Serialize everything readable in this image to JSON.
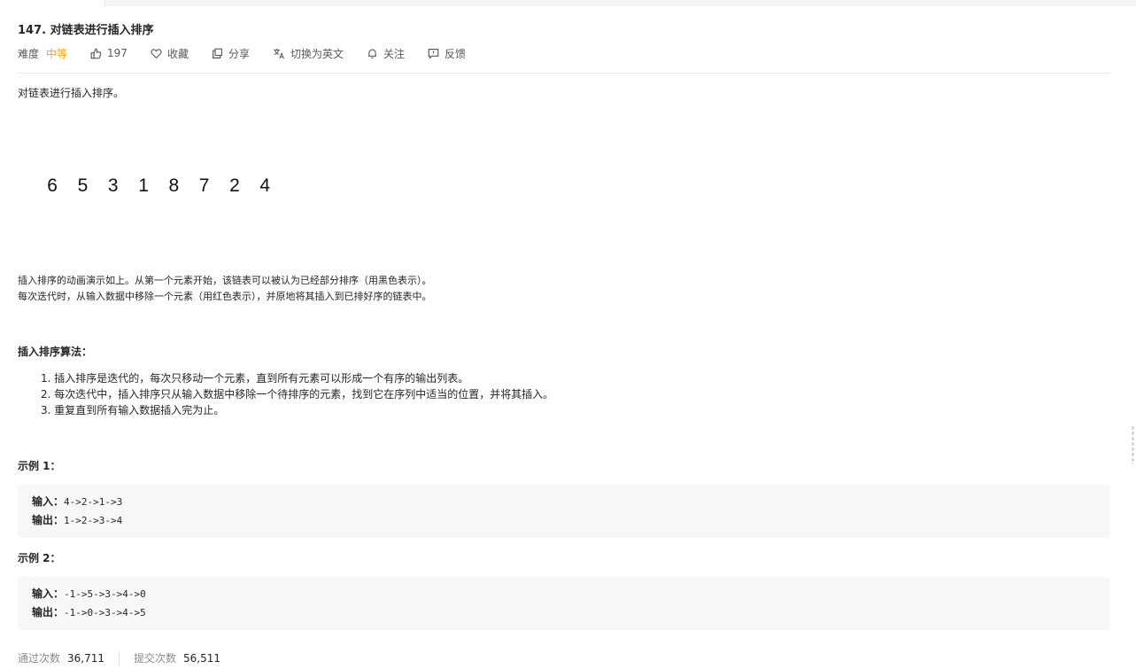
{
  "problem": {
    "title": "147. 对链表进行插入排序",
    "difficulty_label": "难度",
    "difficulty_value": "中等",
    "likes": "197",
    "actions": {
      "favorite": "收藏",
      "share": "分享",
      "translate": "切换为英文",
      "follow": "关注",
      "feedback": "反馈"
    },
    "intro": "对链表进行插入排序。",
    "animation_numbers": [
      "6",
      "5",
      "3",
      "1",
      "8",
      "7",
      "2",
      "4"
    ],
    "desc_lines": [
      "插入排序的动画演示如上。从第一个元素开始，该链表可以被认为已经部分排序（用黑色表示）。",
      "每次迭代时，从输入数据中移除一个元素（用红色表示），并原地将其插入到已排好序的链表中。"
    ],
    "algo_title": "插入排序算法：",
    "algo_steps": [
      "1. 插入排序是迭代的，每次只移动一个元素，直到所有元素可以形成一个有序的输出列表。",
      "2. 每次迭代中，插入排序只从输入数据中移除一个待排序的元素，找到它在序列中适当的位置，并将其插入。",
      "3. 重复直到所有输入数据插入完为止。"
    ],
    "examples": [
      {
        "title": "示例 1：",
        "input_label": "输入：",
        "input": "4->2->1->3",
        "output_label": "输出：",
        "output": "1->2->3->4"
      },
      {
        "title": "示例 2：",
        "input_label": "输入：",
        "input": "-1->5->3->4->0",
        "output_label": "输出：",
        "output": "-1->0->3->4->5"
      }
    ],
    "stats": {
      "accepted_label": "通过次数",
      "accepted_value": "36,711",
      "submissions_label": "提交次数",
      "submissions_value": "56,511"
    },
    "colors": {
      "difficulty": "#ffa116",
      "code_bg": "#f7f7f7"
    },
    "icons": [
      "thumbs-up-icon",
      "heart-icon",
      "share-icon",
      "translate-icon",
      "bell-icon",
      "feedback-icon"
    ]
  }
}
